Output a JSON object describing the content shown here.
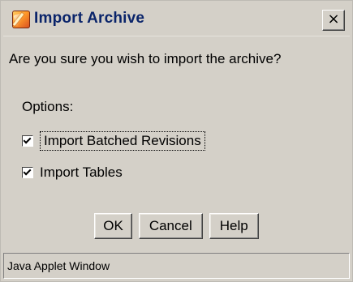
{
  "window": {
    "title": "Import Archive",
    "close_glyph": "×",
    "icon": "import-archive-app-icon"
  },
  "dialog": {
    "question": "Are you sure you wish to import the archive?",
    "options_label": "Options:",
    "options": [
      {
        "label": "Import Batched Revisions",
        "checked": true,
        "focused": true
      },
      {
        "label": "Import Tables",
        "checked": true,
        "focused": false
      }
    ],
    "buttons": {
      "ok": "OK",
      "cancel": "Cancel",
      "help": "Help"
    }
  },
  "status_bar": {
    "text": "Java Applet Window"
  },
  "colors": {
    "window_bg": "#d4d0c8",
    "title_text": "#0a246a",
    "text": "#000000"
  }
}
